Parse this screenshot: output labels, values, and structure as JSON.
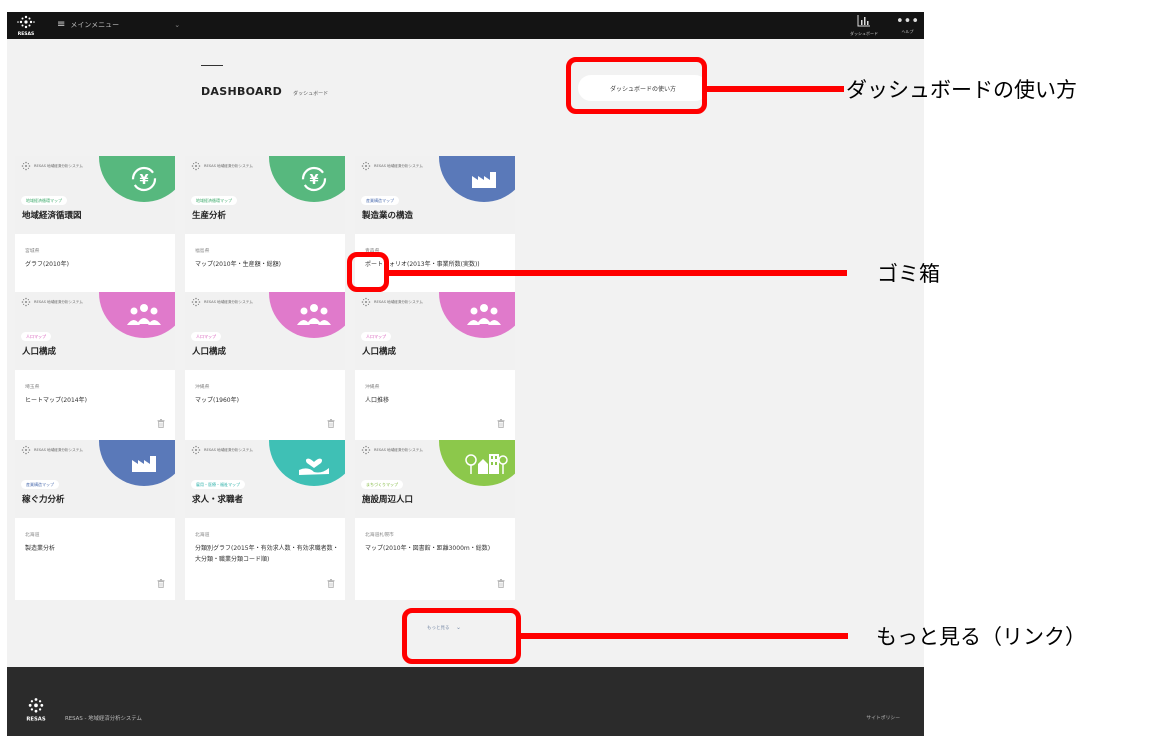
{
  "topbar": {
    "logo_text": "RESAS",
    "menu_label": "メインメニュー",
    "dashboard_label": "ダッシュボード",
    "help_label": "ヘルプ"
  },
  "dashboard": {
    "title_en": "DASHBOARD",
    "title_jp": "ダッシュボード",
    "howto_button": "ダッシュボードの使い方"
  },
  "brand_text": "RESAS 地域経済分析システム",
  "cards": [
    {
      "tag": "地域経済循環マップ",
      "tag_color": "#3daa6b",
      "title": "地域経済循環図",
      "region": "宮城県",
      "desc": "グラフ(2010年)",
      "icon": "yen-circle-icon",
      "circle_color": "#57b87e"
    },
    {
      "tag": "地域経済循環マップ",
      "tag_color": "#3daa6b",
      "title": "生産分析",
      "region": "福島県",
      "desc": "マップ(2010年・生産額・総額)",
      "icon": "yen-circle-icon",
      "circle_color": "#57b87e"
    },
    {
      "tag": "産業構造マップ",
      "tag_color": "#4f6fb0",
      "title": "製造業の構造",
      "region": "青森県",
      "desc": "ポートフォリオ(2013年・事業所数(実数))",
      "icon": "factory-icon",
      "circle_color": "#5a79b9"
    },
    {
      "tag": "人口マップ",
      "tag_color": "#d44fb5",
      "title": "人口構成",
      "region": "埼玉県",
      "desc": "ヒートマップ(2014年)",
      "icon": "people-icon",
      "circle_color": "#e07acb"
    },
    {
      "tag": "人口マップ",
      "tag_color": "#d44fb5",
      "title": "人口構成",
      "region": "沖縄県",
      "desc": "マップ(1960年)",
      "icon": "people-icon",
      "circle_color": "#e07acb"
    },
    {
      "tag": "人口マップ",
      "tag_color": "#d44fb5",
      "title": "人口構成",
      "region": "沖縄県",
      "desc": "人口推移",
      "icon": "people-icon",
      "circle_color": "#e07acb"
    },
    {
      "tag": "産業構造マップ",
      "tag_color": "#4f6fb0",
      "title": "稼ぐ力分析",
      "region": "北海道",
      "desc": "製造業分析",
      "icon": "factory-icon",
      "circle_color": "#5a79b9"
    },
    {
      "tag": "雇用・医療・福祉マップ",
      "tag_color": "#2ab0a8",
      "title": "求人・求職者",
      "region": "北海道",
      "desc": "分類別グラフ(2015年・有効求人数・有効求職者数・大分類・職業分類コード順)",
      "icon": "heart-hand-icon",
      "circle_color": "#3fc0b5"
    },
    {
      "tag": "まちづくりマップ",
      "tag_color": "#7fb83c",
      "title": "施設周辺人口",
      "region": "北海道札幌市",
      "desc": "マップ(2010年・図書館・距離3000m・総数)",
      "icon": "town-icon",
      "circle_color": "#8cc84b"
    }
  ],
  "more_link": "もっと見る",
  "footer": {
    "name": "RESAS - 地域経済分析システム",
    "policy": "サイトポリシー"
  },
  "annotations": {
    "howto": "ダッシュボードの使い方",
    "trash": "ゴミ箱",
    "more": "もっと見る（リンク）",
    "color": "#ff0000"
  }
}
